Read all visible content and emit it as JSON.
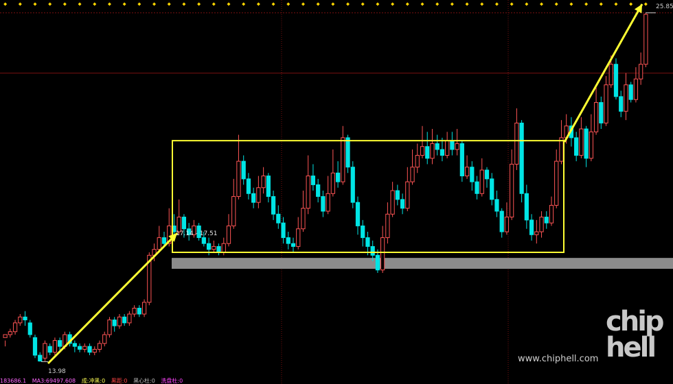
{
  "chart_data": {
    "type": "candlestick",
    "annotations": {
      "high_label": "25.85",
      "low_label": "13.98",
      "range_label": "17.14 - 17.51",
      "consolidation_box": {
        "low": 17.7,
        "high": 21.5
      },
      "resistance_band": {
        "low": 17.14,
        "high": 17.51
      }
    },
    "ylim": [
      13.5,
      26.1
    ],
    "candles": [
      [
        14.8,
        14.9,
        14.7,
        14.5
      ],
      [
        14.9,
        15.0,
        15.1,
        14.8
      ],
      [
        15.0,
        15.3,
        15.4,
        14.9
      ],
      [
        15.3,
        15.5,
        15.6,
        15.2
      ],
      [
        15.5,
        15.4,
        15.7,
        15.2
      ],
      [
        15.3,
        14.9,
        15.4,
        14.8
      ],
      [
        14.8,
        14.2,
        14.9,
        14.1
      ],
      [
        14.2,
        14.0,
        14.3,
        13.98
      ],
      [
        14.1,
        14.6,
        14.7,
        14.0
      ],
      [
        14.5,
        14.3,
        14.6,
        14.2
      ],
      [
        14.3,
        14.7,
        14.8,
        14.2
      ],
      [
        14.7,
        14.5,
        14.8,
        14.3
      ],
      [
        14.5,
        14.9,
        15.0,
        14.4
      ],
      [
        14.9,
        14.6,
        15.0,
        14.5
      ],
      [
        14.6,
        14.5,
        14.7,
        14.3
      ],
      [
        14.5,
        14.4,
        14.6,
        14.3
      ],
      [
        14.4,
        14.5,
        14.6,
        14.3
      ],
      [
        14.5,
        14.3,
        14.6,
        14.2
      ],
      [
        14.3,
        14.4,
        14.5,
        14.2
      ],
      [
        14.4,
        14.6,
        14.7,
        14.3
      ],
      [
        14.6,
        14.9,
        15.0,
        14.5
      ],
      [
        14.9,
        15.4,
        15.5,
        14.8
      ],
      [
        15.4,
        15.2,
        15.5,
        15.0
      ],
      [
        15.2,
        15.5,
        15.6,
        15.1
      ],
      [
        15.5,
        15.3,
        15.6,
        15.2
      ],
      [
        15.3,
        15.6,
        15.7,
        15.2
      ],
      [
        15.6,
        15.8,
        15.9,
        15.5
      ],
      [
        15.8,
        15.6,
        15.9,
        15.5
      ],
      [
        15.6,
        16.0,
        16.1,
        15.5
      ],
      [
        16.0,
        17.6,
        17.7,
        15.9
      ],
      [
        17.6,
        17.8,
        18.0,
        17.4
      ],
      [
        17.8,
        18.2,
        18.6,
        17.7
      ],
      [
        18.2,
        18.0,
        18.4,
        17.9
      ],
      [
        18.0,
        18.6,
        19.2,
        17.9
      ],
      [
        18.6,
        18.4,
        19.0,
        18.2
      ],
      [
        18.4,
        18.9,
        19.5,
        18.3
      ],
      [
        18.9,
        18.5,
        19.0,
        18.2
      ],
      [
        18.5,
        18.3,
        18.7,
        18.1
      ],
      [
        18.3,
        18.6,
        18.8,
        18.2
      ],
      [
        18.6,
        18.2,
        18.7,
        18.1
      ],
      [
        18.2,
        18.0,
        18.4,
        17.9
      ],
      [
        18.0,
        17.8,
        18.2,
        17.6
      ],
      [
        17.8,
        17.9,
        18.1,
        17.7
      ],
      [
        17.9,
        17.7,
        18.0,
        17.6
      ],
      [
        17.7,
        18.0,
        18.2,
        17.6
      ],
      [
        18.0,
        18.6,
        19.0,
        17.9
      ],
      [
        18.6,
        19.6,
        20.2,
        18.5
      ],
      [
        19.6,
        20.8,
        21.7,
        19.5
      ],
      [
        20.8,
        20.2,
        21.0,
        20.0
      ],
      [
        20.2,
        19.7,
        20.4,
        19.5
      ],
      [
        19.7,
        19.4,
        19.9,
        19.2
      ],
      [
        19.4,
        19.9,
        20.3,
        19.2
      ],
      [
        19.9,
        20.3,
        20.6,
        19.7
      ],
      [
        20.3,
        19.6,
        20.4,
        19.4
      ],
      [
        19.6,
        19.0,
        19.8,
        18.8
      ],
      [
        19.0,
        18.7,
        19.3,
        18.5
      ],
      [
        18.7,
        18.2,
        18.9,
        18.0
      ],
      [
        18.2,
        18.0,
        18.4,
        17.8
      ],
      [
        18.0,
        17.9,
        18.2,
        17.7
      ],
      [
        17.9,
        18.5,
        18.9,
        17.8
      ],
      [
        18.5,
        19.2,
        19.8,
        18.4
      ],
      [
        19.2,
        20.3,
        21.0,
        19.0
      ],
      [
        20.3,
        20.0,
        20.7,
        19.8
      ],
      [
        20.0,
        19.6,
        20.2,
        19.4
      ],
      [
        19.6,
        19.1,
        19.8,
        18.9
      ],
      [
        19.1,
        19.7,
        20.3,
        19.0
      ],
      [
        19.7,
        20.4,
        21.2,
        19.6
      ],
      [
        20.4,
        20.1,
        20.8,
        19.9
      ],
      [
        20.1,
        21.6,
        22.0,
        20.0
      ],
      [
        21.6,
        20.6,
        21.7,
        20.4
      ],
      [
        20.6,
        19.4,
        20.8,
        19.2
      ],
      [
        19.4,
        18.6,
        19.6,
        18.3
      ],
      [
        18.6,
        18.2,
        18.8,
        17.9
      ],
      [
        18.2,
        17.9,
        18.4,
        17.6
      ],
      [
        17.9,
        17.6,
        18.1,
        17.4
      ],
      [
        17.6,
        17.1,
        17.8,
        17.0
      ],
      [
        17.1,
        18.2,
        18.6,
        17.0
      ],
      [
        18.2,
        19.0,
        19.4,
        18.0
      ],
      [
        19.0,
        19.8,
        20.1,
        18.9
      ],
      [
        19.8,
        19.5,
        20.0,
        19.3
      ],
      [
        19.5,
        19.2,
        19.7,
        19.0
      ],
      [
        19.2,
        20.1,
        20.6,
        19.1
      ],
      [
        20.1,
        20.6,
        21.2,
        20.0
      ],
      [
        20.6,
        21.0,
        21.4,
        20.4
      ],
      [
        21.0,
        21.3,
        22.0,
        20.9
      ],
      [
        21.3,
        20.9,
        21.8,
        20.7
      ],
      [
        20.9,
        21.4,
        21.9,
        20.7
      ],
      [
        21.4,
        21.2,
        21.7,
        21.0
      ],
      [
        21.2,
        21.0,
        21.6,
        20.8
      ],
      [
        21.0,
        21.5,
        21.8,
        20.9
      ],
      [
        21.5,
        21.2,
        21.8,
        21.0
      ],
      [
        21.2,
        21.4,
        21.9,
        21.0
      ],
      [
        21.4,
        20.3,
        21.5,
        20.1
      ],
      [
        20.3,
        20.6,
        21.0,
        20.2
      ],
      [
        20.6,
        20.1,
        20.8,
        19.8
      ],
      [
        20.1,
        19.7,
        20.3,
        19.5
      ],
      [
        19.7,
        20.5,
        20.9,
        19.6
      ],
      [
        20.5,
        20.2,
        20.6,
        19.9
      ],
      [
        20.2,
        19.5,
        20.4,
        19.3
      ],
      [
        19.5,
        19.1,
        19.8,
        18.9
      ],
      [
        19.1,
        18.4,
        19.2,
        18.2
      ],
      [
        18.4,
        18.9,
        19.4,
        18.3
      ],
      [
        18.9,
        20.7,
        21.2,
        18.8
      ],
      [
        20.7,
        22.1,
        22.6,
        20.5
      ],
      [
        22.1,
        19.7,
        22.2,
        19.4
      ],
      [
        19.7,
        18.8,
        20.0,
        18.5
      ],
      [
        18.8,
        18.3,
        19.0,
        18.1
      ],
      [
        18.3,
        18.4,
        18.8,
        18.0
      ],
      [
        18.4,
        18.9,
        19.1,
        18.2
      ],
      [
        18.9,
        18.7,
        19.1,
        18.5
      ],
      [
        18.7,
        19.3,
        19.6,
        18.6
      ],
      [
        19.3,
        20.8,
        21.2,
        19.2
      ],
      [
        20.8,
        21.6,
        22.2,
        20.7
      ],
      [
        21.6,
        22.0,
        22.4,
        21.4
      ],
      [
        22.0,
        21.6,
        22.3,
        21.3
      ],
      [
        21.6,
        21.0,
        21.8,
        20.8
      ],
      [
        21.0,
        21.9,
        22.3,
        20.9
      ],
      [
        21.9,
        20.9,
        22.0,
        20.6
      ],
      [
        20.9,
        21.8,
        22.4,
        20.8
      ],
      [
        21.8,
        22.8,
        23.3,
        21.7
      ],
      [
        22.8,
        22.1,
        23.0,
        21.9
      ],
      [
        22.1,
        23.4,
        23.7,
        22.0
      ],
      [
        23.4,
        24.1,
        24.4,
        23.3
      ],
      [
        24.1,
        23.0,
        24.3,
        22.9
      ],
      [
        23.0,
        22.5,
        23.2,
        22.3
      ],
      [
        22.5,
        23.4,
        23.8,
        22.2
      ],
      [
        23.4,
        22.9,
        23.5,
        22.8
      ],
      [
        22.9,
        23.6,
        24.0,
        22.8
      ],
      [
        23.6,
        24.1,
        24.5,
        23.4
      ],
      [
        24.1,
        25.8,
        25.85,
        24.0
      ]
    ]
  },
  "footer": {
    "items": [
      {
        "text": "183686.1",
        "color": "#ff66ff"
      },
      {
        "text": "MA3:69497.608",
        "color": "#ff66ff"
      },
      {
        "text": "成:冲黑:0",
        "color": "#ffff55"
      },
      {
        "text": "黑距:0",
        "color": "#ff4444"
      },
      {
        "text": "黑心杜:0",
        "color": "#bbbbbb"
      },
      {
        "text": "洗盘杜:0",
        "color": "#ff44ff"
      }
    ]
  },
  "watermark": {
    "site": "www.chiphell.com",
    "logo": "chip\nhell"
  },
  "colors": {
    "up": "#ff5555",
    "down": "#00e5e5",
    "box": "#ffff33",
    "band": "#8c8c8c",
    "grid": "#7a1010",
    "marker": "#ffd700"
  }
}
